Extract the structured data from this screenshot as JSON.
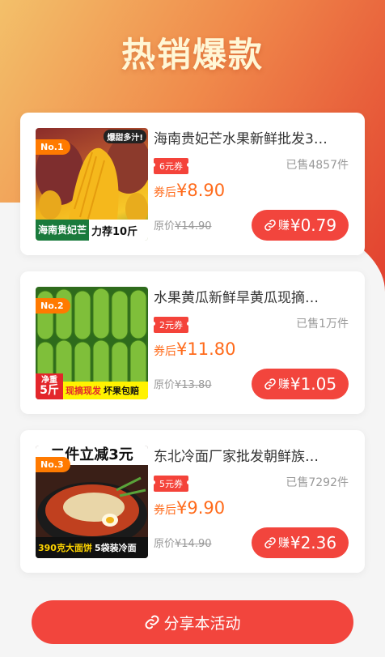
{
  "page": {
    "title": "热销爆款"
  },
  "products": [
    {
      "rank": "No.1",
      "title": "海南贵妃芒水果新鲜批发3…",
      "coupon": "6元券",
      "sold": "已售4857件",
      "after_label": "券后",
      "after_price": "¥8.90",
      "orig_label": "原价",
      "orig_price": "¥14.90",
      "earn_label": "赚",
      "earn_amount": "¥0.79",
      "thumb_tag": "爆甜多汁!",
      "thumb_left": "海南贵妃芒",
      "thumb_right": "力荐10斤"
    },
    {
      "rank": "No.2",
      "title": "水果黄瓜新鲜旱黄瓜现摘…",
      "coupon": "2元券",
      "sold": "已售1万件",
      "after_label": "券后",
      "after_price": "¥11.80",
      "orig_label": "原价",
      "orig_price": "¥13.80",
      "earn_label": "赚",
      "earn_amount": "¥1.05",
      "thumb_tag1": "净重",
      "thumb_tag2": "5斤",
      "thumb_mid": "现摘现发",
      "thumb_right": "坏果包赔"
    },
    {
      "rank": "No.3",
      "title": "东北冷面厂家批发朝鲜族…",
      "coupon": "5元券",
      "sold": "已售7292件",
      "after_label": "券后",
      "after_price": "¥9.90",
      "orig_label": "原价",
      "orig_price": "¥14.90",
      "earn_label": "赚",
      "earn_amount": "¥2.36",
      "thumb_head": "二件立减3元",
      "thumb_left": "390克大面饼",
      "thumb_right": "5袋装冷面"
    }
  ],
  "share": {
    "label": "分享本活动"
  },
  "colors": {
    "accent": "#f2453d",
    "price": "#ff6a1a",
    "rank": "#ff7a00"
  }
}
